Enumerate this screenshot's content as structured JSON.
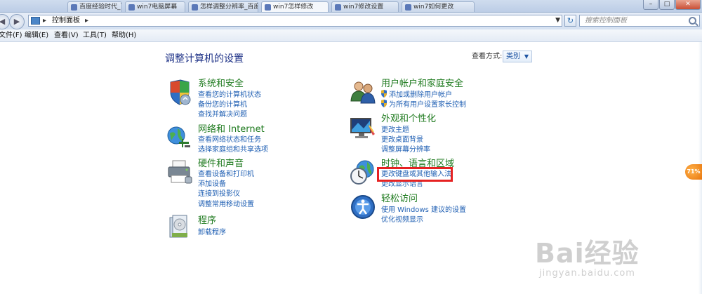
{
  "tabs": [
    {
      "label": "百度经验时代_百度"
    },
    {
      "label": "win7电脑屏幕"
    },
    {
      "label": "怎样调整分辨率_百度"
    },
    {
      "label": "win7怎样修改"
    },
    {
      "label": "win7修改设置"
    },
    {
      "label": "win7如何更改"
    }
  ],
  "window_buttons": {
    "minimize": "–",
    "maximize": "□",
    "close": "✕"
  },
  "address": {
    "path": "控制面板",
    "separator": "▸"
  },
  "search": {
    "placeholder": "搜索控制面板"
  },
  "menu": [
    "文件(F)",
    "编辑(E)",
    "查看(V)",
    "工具(T)",
    "帮助(H)"
  ],
  "page_title": "调整计算机的设置",
  "view_by": {
    "label": "查看方式:",
    "value": "类别"
  },
  "categories_left": [
    {
      "title": "系统和安全",
      "icon": "security-shield-icon",
      "links": [
        "查看您的计算机状态",
        "备份您的计算机",
        "查找并解决问题"
      ]
    },
    {
      "title": "网络和 Internet",
      "icon": "network-globe-icon",
      "links": [
        "查看网络状态和任务",
        "选择家庭组和共享选项"
      ]
    },
    {
      "title": "硬件和声音",
      "icon": "printer-icon",
      "links": [
        "查看设备和打印机",
        "添加设备",
        "连接到投影仪",
        "调整常用移动设置"
      ]
    },
    {
      "title": "程序",
      "icon": "programs-icon",
      "links": [
        "卸载程序"
      ]
    }
  ],
  "categories_right": [
    {
      "title": "用户帐户和家庭安全",
      "icon": "users-icon",
      "links": [
        "添加或删除用户帐户",
        "为所有用户设置家长控制"
      ]
    },
    {
      "title": "外观和个性化",
      "icon": "monitor-icon",
      "links": [
        "更改主题",
        "更改桌面背景",
        "调整屏幕分辨率"
      ]
    },
    {
      "title": "时钟、语言和区域",
      "icon": "clock-globe-icon",
      "links": [
        "更改键盘或其他输入法",
        "更改显示语言"
      ]
    },
    {
      "title": "轻松访问",
      "icon": "ease-of-access-icon",
      "links": [
        "使用 Windows 建议的设置",
        "优化视频显示"
      ]
    }
  ],
  "side_badge": "71%",
  "watermark": {
    "main": "Bai经验",
    "sub": "jingyan.baidu.com"
  },
  "colors": {
    "title_green": "#1e7a1e",
    "link_blue": "#1f5fb3",
    "highlight_red": "#e62222"
  }
}
